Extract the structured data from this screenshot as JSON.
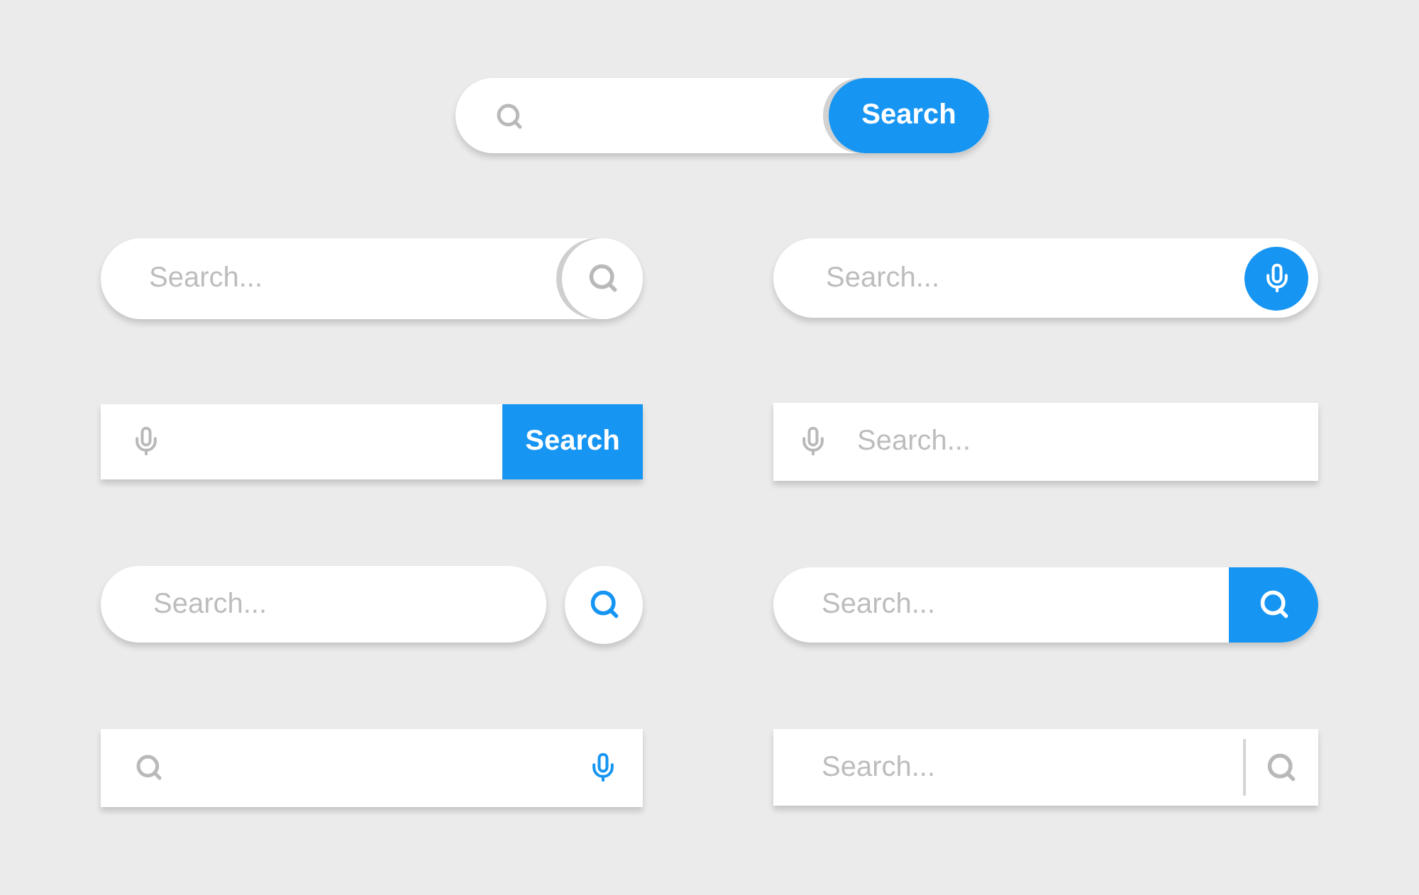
{
  "featured": {
    "kind": "pill-button",
    "button": "Search"
  },
  "bars": [
    {
      "kind": "pill-circle",
      "placeholder": "Search..."
    },
    {
      "kind": "pill-mic",
      "placeholder": "Search..."
    },
    {
      "kind": "rect-button",
      "button": "Search"
    },
    {
      "kind": "rect-mic",
      "placeholder": "Search..."
    },
    {
      "kind": "pill-split",
      "placeholder": "Search..."
    },
    {
      "kind": "pill-tab",
      "placeholder": "Search..."
    },
    {
      "kind": "rect-icons"
    },
    {
      "kind": "rect-divider",
      "placeholder": "Search..."
    }
  ]
}
